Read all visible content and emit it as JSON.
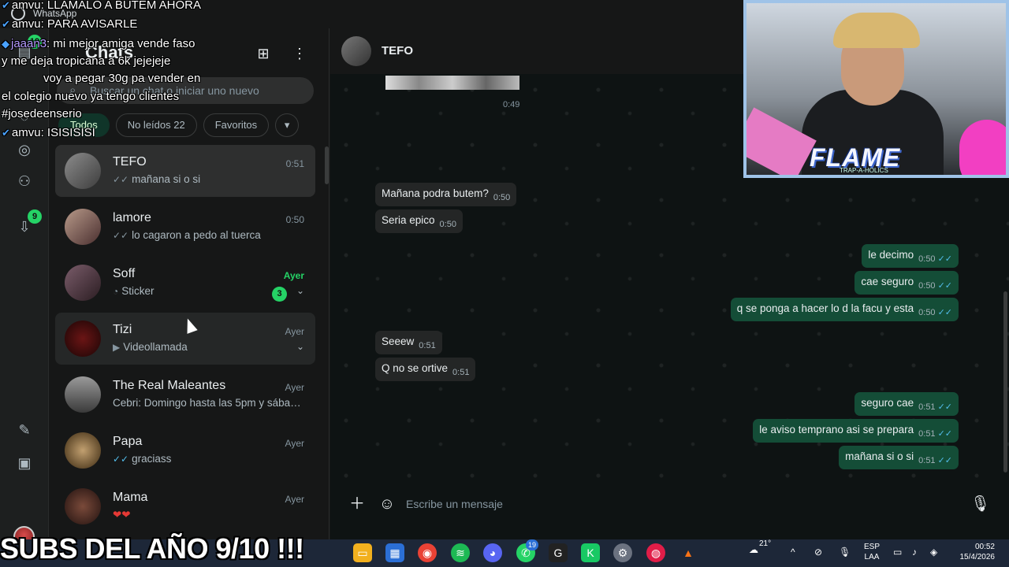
{
  "window": {
    "title": "WhatsApp"
  },
  "rail": {
    "chats_badge": "19",
    "status_badge": "9"
  },
  "list": {
    "title": "Chats",
    "search_placeholder": "Buscar un chat o iniciar uno nuevo",
    "chips": [
      {
        "label": "Todos"
      },
      {
        "label": "No leídos 22"
      },
      {
        "label": "Favoritos"
      }
    ],
    "rows": [
      {
        "name": "TEFO",
        "time": "0:51",
        "preview": "mañana si o si",
        "tick": "✓✓"
      },
      {
        "name": "lamore",
        "time": "0:50",
        "preview": "lo cagaron a pedo al tuerca",
        "tick": "✓✓"
      },
      {
        "name": "Soff",
        "time": "Ayer",
        "preview": "Sticker",
        "badge": "3"
      },
      {
        "name": "Tizi",
        "time": "Ayer",
        "preview": "Videollamada"
      },
      {
        "name": "The Real Maleantes",
        "time": "Ayer",
        "preview": "Cebri: Domingo hasta las 5pm y sábad..."
      },
      {
        "name": "Papa",
        "time": "Ayer",
        "preview": "graciass",
        "tick": "✓✓"
      },
      {
        "name": "Mama",
        "time": "Ayer",
        "preview": "❤❤"
      }
    ]
  },
  "conversation": {
    "contact": "TEFO",
    "sticker_time": "0:49",
    "messages": [
      {
        "dir": "in",
        "text": "Mañana podra butem?",
        "time": "0:50"
      },
      {
        "dir": "in",
        "text": "Seria epico",
        "time": "0:50"
      },
      {
        "dir": "out",
        "text": "le decimo",
        "time": "0:50"
      },
      {
        "dir": "out",
        "text": "cae seguro",
        "time": "0:50"
      },
      {
        "dir": "out",
        "text": "q se ponga a hacer lo d la facu y esta",
        "time": "0:50"
      },
      {
        "dir": "in",
        "text": "Seeew",
        "time": "0:51"
      },
      {
        "dir": "in",
        "text": "Q no se ortive",
        "time": "0:51"
      },
      {
        "dir": "out",
        "text": "seguro cae",
        "time": "0:51"
      },
      {
        "dir": "out",
        "text": "le aviso temprano asi se prepara",
        "time": "0:51"
      },
      {
        "dir": "out",
        "text": "mañana si o si",
        "time": "0:51"
      }
    ],
    "composer_placeholder": "Escribe un mensaje"
  },
  "overlay": {
    "lines": [
      {
        "user": "amvu",
        "text": ": LLAMALO A BUTEM AHORA"
      },
      {
        "user": "amvu",
        "text": ": PARA AVISARLE"
      },
      {
        "user": "jaaan3",
        "text": ": mi mejor amiga vende faso"
      },
      {
        "user": "",
        "text": "y me deja tropicana a 6k jejejeje"
      },
      {
        "user": "",
        "text": "voy a pegar 30g pa vender en"
      },
      {
        "user": "",
        "text": "el colegio nuevo ya tengo clientes"
      },
      {
        "user": "",
        "text": "#josedeenserio"
      },
      {
        "user": "amvu",
        "text": ": ISISISISI"
      }
    ],
    "banner": "SUBS DEL AÑO 9/10 !!!"
  },
  "webcam": {
    "brand": "FLAME",
    "tagline": "TRAP-A-HOLICS"
  },
  "taskbar": {
    "weather": "21°",
    "lang_line1": "ESP",
    "lang_line2": "LAA",
    "time": "00:52",
    "date": "15/4/2026",
    "whatsapp_badge": "19"
  },
  "colors": {
    "accent": "#25d366",
    "outgoing": "#144d37",
    "incoming": "#242626",
    "read_tick": "#53bdeb"
  }
}
